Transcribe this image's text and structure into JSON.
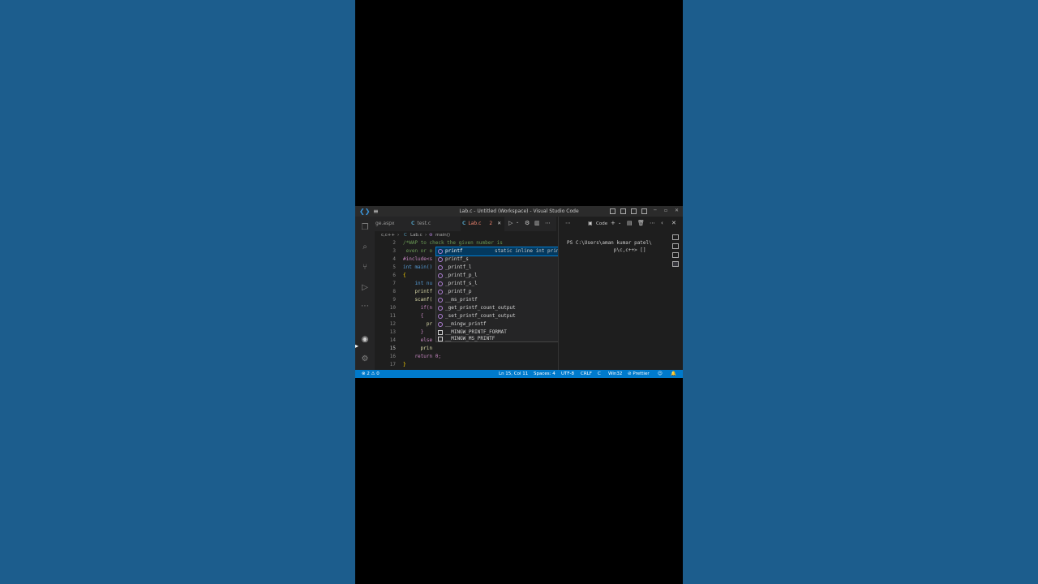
{
  "window": {
    "title": "Lab.c - Untitled (Workspace) - Visual Studio Code",
    "controls": [
      "─",
      "▫",
      "✕"
    ]
  },
  "tabs": [
    {
      "label": "ge.aspx",
      "icon": "",
      "state": ""
    },
    {
      "label": "test.c",
      "icon": "C",
      "state": ""
    },
    {
      "label": "Lab.c",
      "icon": "C",
      "state": "2",
      "active": true
    }
  ],
  "breadcrumb": {
    "folder": "c,c++",
    "file": "Lab.c",
    "symbol": "main()"
  },
  "editor": {
    "lines": [
      {
        "n": "2",
        "text": "/*WAP to check the given number is"
      },
      {
        "n": "3",
        "text": " even or o"
      },
      {
        "n": "4",
        "text": "#include<s"
      },
      {
        "n": "5",
        "text": "int main()"
      },
      {
        "n": "6",
        "text": "{"
      },
      {
        "n": "7",
        "text": "    int nu"
      },
      {
        "n": "8",
        "text": "    printf"
      },
      {
        "n": "9",
        "text": "    scanf("
      },
      {
        "n": "10",
        "text": "      if(n"
      },
      {
        "n": "11",
        "text": "      {"
      },
      {
        "n": "12",
        "text": "        pr"
      },
      {
        "n": "13",
        "text": "      }"
      },
      {
        "n": "14",
        "text": "      else"
      },
      {
        "n": "15",
        "text": "      prin"
      },
      {
        "n": "16",
        "text": "    return 0;"
      },
      {
        "n": "17",
        "text": "}"
      }
    ]
  },
  "suggestions": {
    "detail": "static inline int printf(const char *__fo...",
    "items": [
      {
        "label": "printf",
        "kind": "function"
      },
      {
        "label": "printf_s",
        "kind": "function"
      },
      {
        "label": "_printf_l",
        "kind": "function"
      },
      {
        "label": "_printf_p_l",
        "kind": "function"
      },
      {
        "label": "_printf_s_l",
        "kind": "function"
      },
      {
        "label": "_printf_p",
        "kind": "function"
      },
      {
        "label": "__ms_printf",
        "kind": "function"
      },
      {
        "label": "_get_printf_count_output",
        "kind": "function"
      },
      {
        "label": "_set_printf_count_output",
        "kind": "function"
      },
      {
        "label": "__mingw_printf",
        "kind": "function"
      },
      {
        "label": "__MINGW_PRINTF_FORMAT",
        "kind": "keyword"
      },
      {
        "label": "__MINGW_MS_PRINTF",
        "kind": "keyword"
      }
    ]
  },
  "panel": {
    "label": "Code",
    "terminal_lines": [
      "PS C:\\Users\\aman kumar patel\\",
      "                p\\c,c++> []"
    ]
  },
  "statusbar": {
    "problems": "⊗ 2 ⚠ 0",
    "position": "Ln 15, Col 11",
    "spaces": "Spaces: 4",
    "encoding": "UTF-8",
    "eol": "CRLF",
    "language": "C",
    "platform": "Win32",
    "formatter": "⊘ Prettier"
  }
}
